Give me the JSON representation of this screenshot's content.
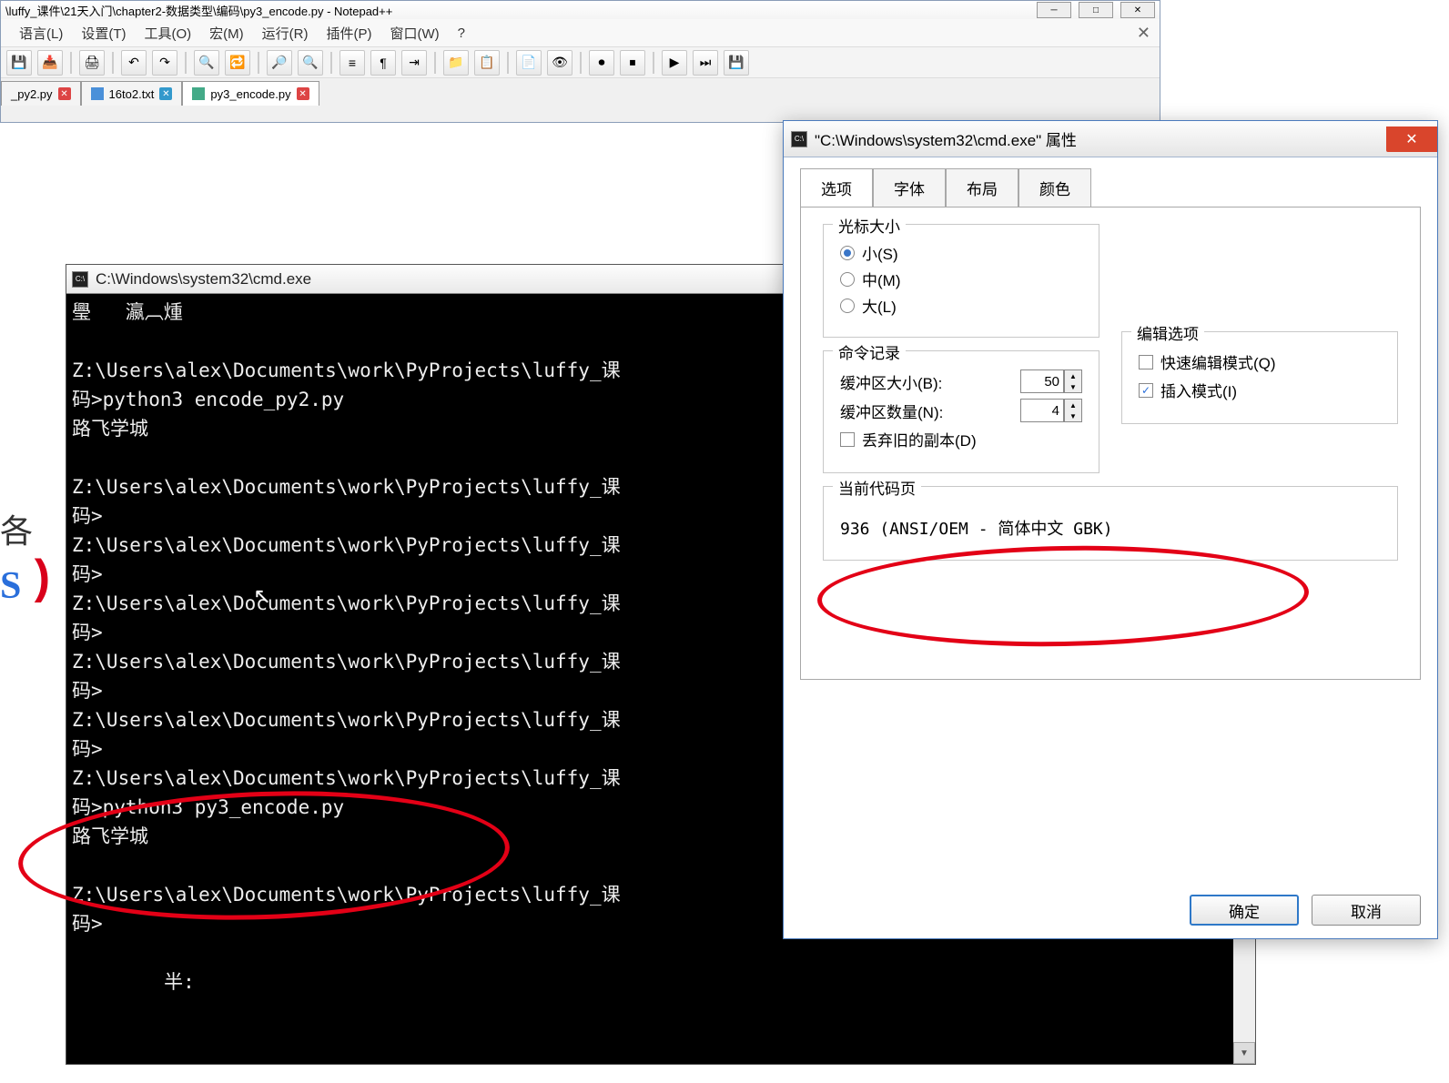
{
  "notepadpp": {
    "title": "\\luffy_课件\\21天入门\\chapter2-数据类型\\编码\\py3_encode.py - Notepad++",
    "menu": [
      "语言(L)",
      "设置(T)",
      "工具(O)",
      "宏(M)",
      "运行(R)",
      "插件(P)",
      "窗口(W)",
      "?"
    ],
    "tabs": [
      {
        "label": "_py2.py"
      },
      {
        "label": "16to2.txt"
      },
      {
        "label": "py3_encode.py"
      }
    ]
  },
  "leftFragments": {
    "line1": "各",
    "line2": "S"
  },
  "cmd": {
    "title": "C:\\Windows\\system32\\cmd.exe",
    "lines": [
      "璺   瀛︹煄",
      "",
      "Z:\\Users\\alex\\Documents\\work\\PyProjects\\luffy_课",
      "码>python3 encode_py2.py",
      "路飞学城",
      "",
      "Z:\\Users\\alex\\Documents\\work\\PyProjects\\luffy_课",
      "码>",
      "Z:\\Users\\alex\\Documents\\work\\PyProjects\\luffy_课",
      "码>",
      "Z:\\Users\\alex\\Documents\\work\\PyProjects\\luffy_课",
      "码>",
      "Z:\\Users\\alex\\Documents\\work\\PyProjects\\luffy_课",
      "码>",
      "Z:\\Users\\alex\\Documents\\work\\PyProjects\\luffy_课",
      "码>",
      "Z:\\Users\\alex\\Documents\\work\\PyProjects\\luffy_课",
      "码>python3 py3_encode.py",
      "路飞学城",
      "",
      "Z:\\Users\\alex\\Documents\\work\\PyProjects\\luffy_课",
      "码>",
      "",
      "        半:"
    ]
  },
  "props": {
    "title": "\"C:\\Windows\\system32\\cmd.exe\" 属性",
    "tabs": [
      "选项",
      "字体",
      "布局",
      "颜色"
    ],
    "cursorSize": {
      "legend": "光标大小",
      "options": [
        "小(S)",
        "中(M)",
        "大(L)"
      ],
      "selected": 0
    },
    "cmdHistory": {
      "legend": "命令记录",
      "bufferLabel": "缓冲区大小(B):",
      "bufferValue": "50",
      "countLabel": "缓冲区数量(N):",
      "countValue": "4",
      "discardLabel": "丢弃旧的副本(D)"
    },
    "editOptions": {
      "legend": "编辑选项",
      "quickLabel": "快速编辑模式(Q)",
      "insertLabel": "插入模式(I)"
    },
    "codepage": {
      "legend": "当前代码页",
      "text": "936    (ANSI/OEM - 简体中文 GBK)"
    },
    "okLabel": "确定",
    "cancelLabel": "取消"
  }
}
